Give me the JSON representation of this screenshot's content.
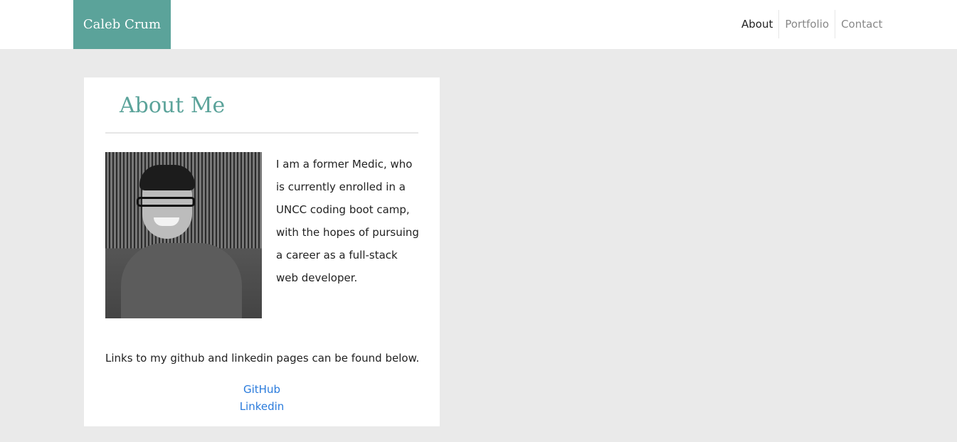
{
  "navbar": {
    "brand": "Caleb Crum",
    "links": [
      {
        "label": "About",
        "active": true
      },
      {
        "label": "Portfolio",
        "active": false
      },
      {
        "label": "Contact",
        "active": false
      }
    ]
  },
  "about": {
    "title": "About Me",
    "bio": "I am a former Medic, who is currently enrolled in a UNCC coding boot camp, with the hopes of pursuing a career as a full-stack web developer.",
    "links_intro": "Links to my github and linkedin pages can be found below.",
    "links": {
      "github": "GitHub",
      "linkedin": "Linkedin"
    }
  },
  "colors": {
    "accent": "#5ba39a",
    "background": "#eaeaea",
    "link": "#2a7bdc"
  }
}
